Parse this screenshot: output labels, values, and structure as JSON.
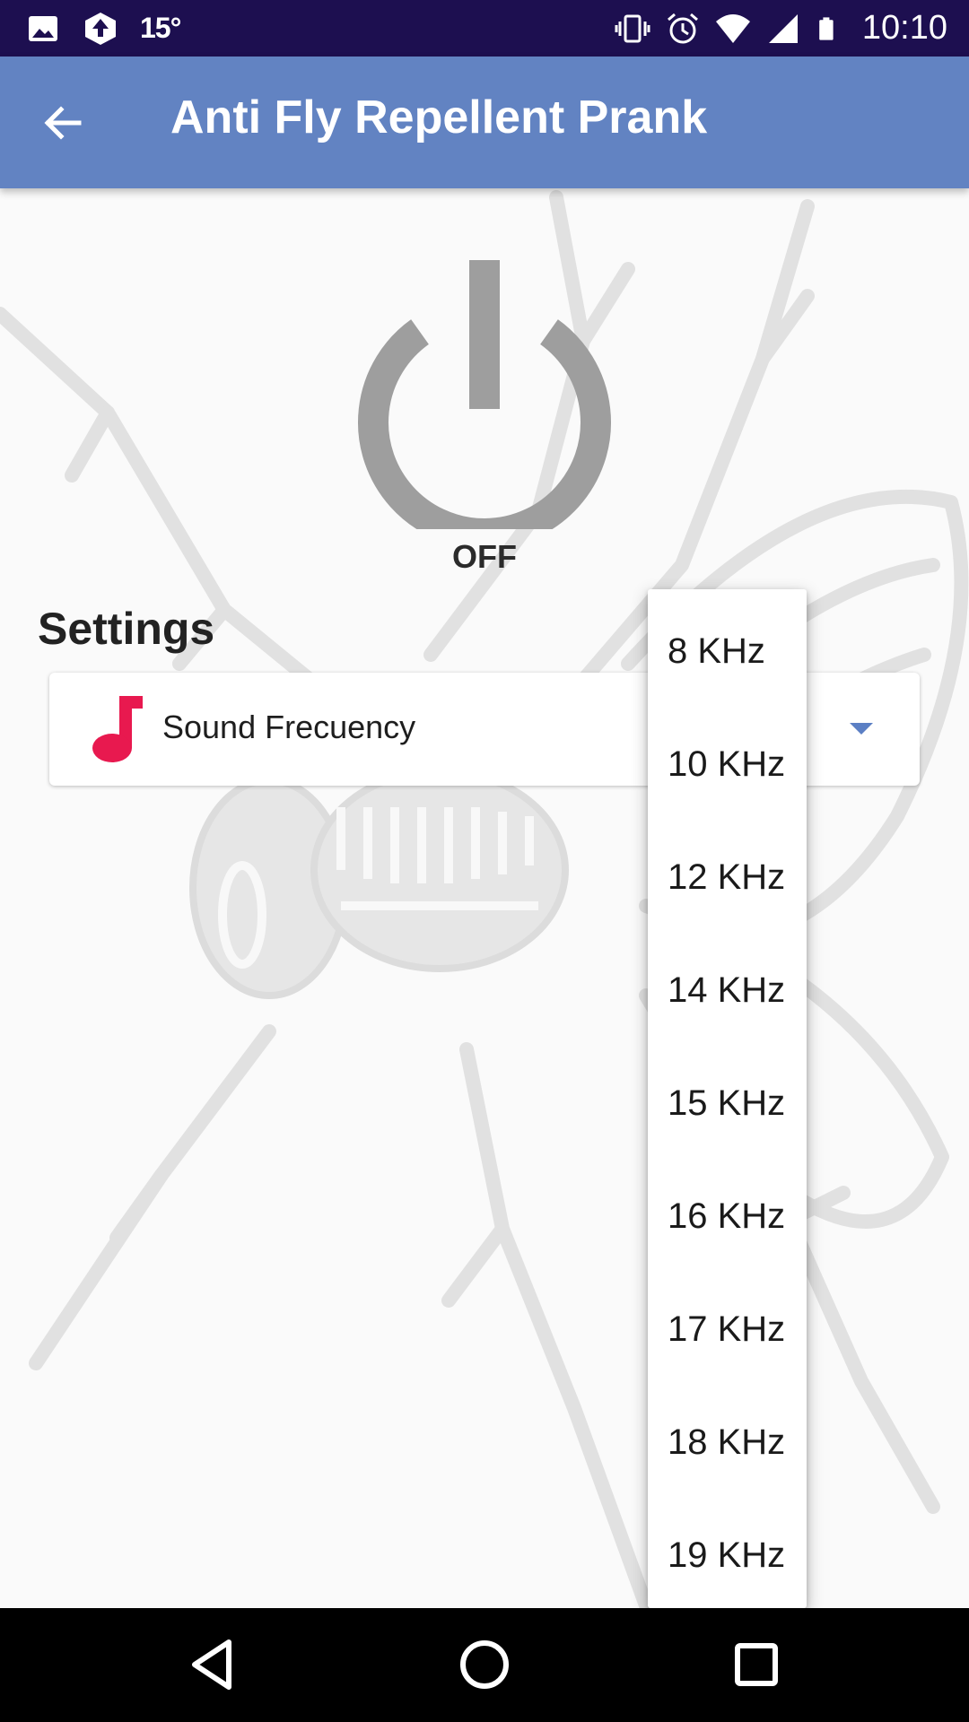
{
  "status_bar": {
    "temperature": "15°",
    "time": "10:10",
    "left_icons": [
      "image-icon",
      "upload-icon"
    ],
    "right_icons": [
      "vibrate-icon",
      "alarm-icon",
      "wifi-icon",
      "signal-icon",
      "battery-icon"
    ]
  },
  "app_bar": {
    "title": "Anti Fly Repellent Prank",
    "back_icon": "arrow-back-icon"
  },
  "main": {
    "power_state": "OFF",
    "settings_title": "Settings",
    "setting": {
      "label": "Sound Frecuency",
      "icon": "music-note-icon"
    }
  },
  "dropdown": {
    "options": [
      "8 KHz",
      "10 KHz",
      "12 KHz",
      "14 KHz",
      "15 KHz",
      "16 KHz",
      "17 KHz",
      "18 KHz",
      "19 KHz"
    ]
  },
  "colors": {
    "status_bar": "#1d0f50",
    "app_bar": "#6283c2",
    "accent_icon": "#e8194f",
    "caret": "#5b7fc4",
    "power_icon": "#9e9e9e"
  }
}
